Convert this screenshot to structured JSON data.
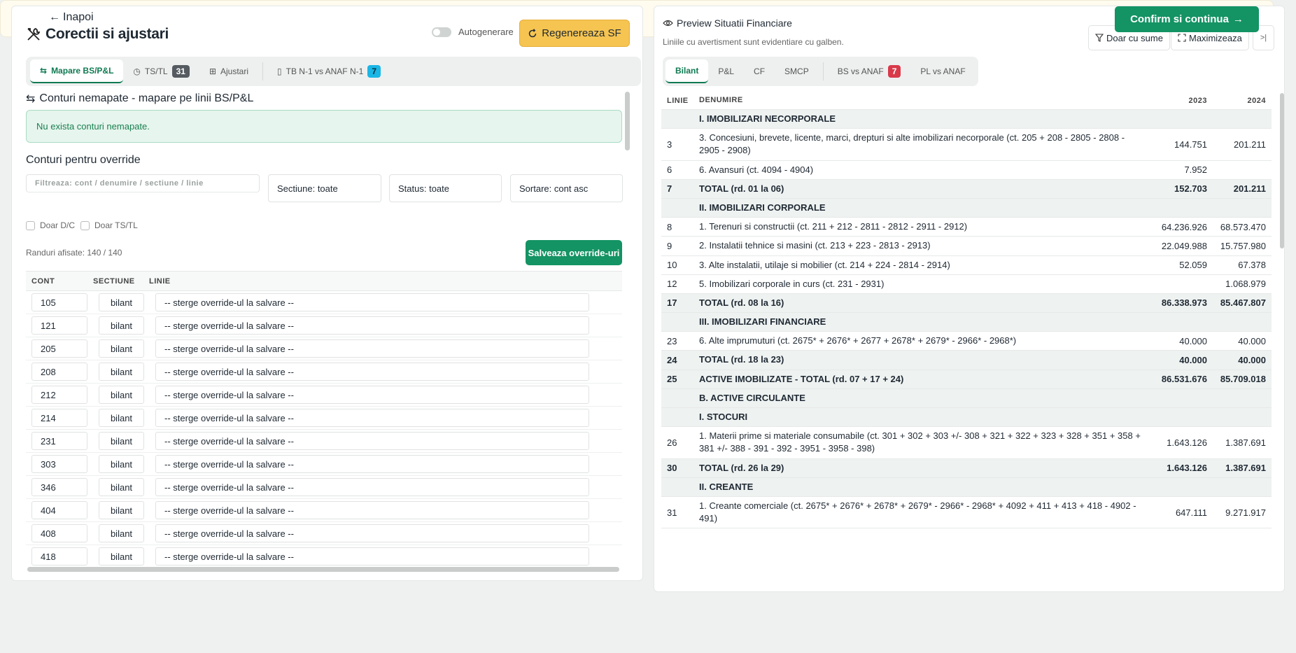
{
  "left": {
    "title": "Corectii si ajustari",
    "autogen_label": "Autogenerare",
    "regen_label": "Regenereaza SF",
    "tabs": [
      {
        "label": "Mapare BS/P&L",
        "badge": null
      },
      {
        "label": "TS/TL",
        "badge": "31"
      },
      {
        "label": "Ajustari",
        "badge": null
      },
      {
        "label": "TB N-1 vs ANAF N-1",
        "badge": "7"
      }
    ],
    "unmapped_title": "Conturi nemapate - mapare pe linii BS/P&L",
    "unmapped_msg": "Nu exista conturi nemapate.",
    "override_title": "Conturi pentru override",
    "filter_placeholder": "Filtreaza: cont / denumire / sectiune / linie",
    "section_select": "Sectiune: toate",
    "status_select": "Status: toate",
    "sort_select": "Sortare: cont asc",
    "chk_dc": "Doar D/C",
    "chk_tstl": "Doar TS/TL",
    "rows_info": "Randuri afisate: 140 / 140",
    "save_label": "Salveaza override-uri",
    "columns": [
      "CONT",
      "SECTIUNE",
      "LINIE"
    ],
    "rows": [
      {
        "cont": "105",
        "sectiune": "bilant",
        "linie": "-- sterge override-ul la salvare --"
      },
      {
        "cont": "121",
        "sectiune": "bilant",
        "linie": "-- sterge override-ul la salvare --"
      },
      {
        "cont": "205",
        "sectiune": "bilant",
        "linie": "-- sterge override-ul la salvare --"
      },
      {
        "cont": "208",
        "sectiune": "bilant",
        "linie": "-- sterge override-ul la salvare --"
      },
      {
        "cont": "212",
        "sectiune": "bilant",
        "linie": "-- sterge override-ul la salvare --"
      },
      {
        "cont": "214",
        "sectiune": "bilant",
        "linie": "-- sterge override-ul la salvare --"
      },
      {
        "cont": "231",
        "sectiune": "bilant",
        "linie": "-- sterge override-ul la salvare --"
      },
      {
        "cont": "303",
        "sectiune": "bilant",
        "linie": "-- sterge override-ul la salvare --"
      },
      {
        "cont": "346",
        "sectiune": "bilant",
        "linie": "-- sterge override-ul la salvare --"
      },
      {
        "cont": "404",
        "sectiune": "bilant",
        "linie": "-- sterge override-ul la salvare --"
      },
      {
        "cont": "408",
        "sectiune": "bilant",
        "linie": "-- sterge override-ul la salvare --"
      },
      {
        "cont": "418",
        "sectiune": "bilant",
        "linie": "-- sterge override-ul la salvare --"
      }
    ]
  },
  "right": {
    "title": "Preview Situatii Financiare",
    "subtitle": "Liniile cu avertisment sunt evidentiare cu galben.",
    "btn_sums": "Doar cu sume",
    "btn_max": "Maximizeaza",
    "btn_collapse": ">|",
    "tabs": [
      {
        "label": "Bilant",
        "badge": null
      },
      {
        "label": "P&L",
        "badge": null
      },
      {
        "label": "CF",
        "badge": null
      },
      {
        "label": "SMCP",
        "badge": null
      },
      {
        "label": "BS vs ANAF",
        "badge": "7"
      },
      {
        "label": "PL vs ANAF",
        "badge": null
      }
    ],
    "columns": [
      "LINIE",
      "DENUMIRE",
      "2023",
      "2024"
    ],
    "rows": [
      {
        "linie": "",
        "den": "I. IMOBILIZARI NECORPORALE",
        "v23": "",
        "v24": "",
        "kind": "tot"
      },
      {
        "linie": "3",
        "den": "3. Concesiuni, brevete, licente, marci, drepturi si alte imobilizari necorporale (ct. 205 + 208 - 2805 - 2808 - 2905 - 2908)",
        "v23": "144.751",
        "v24": "201.211",
        "kind": ""
      },
      {
        "linie": "6",
        "den": "6. Avansuri (ct. 4094 - 4904)",
        "v23": "7.952",
        "v24": "",
        "kind": ""
      },
      {
        "linie": "7",
        "den": "TOTAL (rd. 01 la 06)",
        "v23": "152.703",
        "v24": "201.211",
        "kind": "tot"
      },
      {
        "linie": "",
        "den": "II. IMOBILIZARI CORPORALE",
        "v23": "",
        "v24": "",
        "kind": "tot"
      },
      {
        "linie": "8",
        "den": "1. Terenuri si constructii (ct. 211 + 212 - 2811 - 2812 - 2911 - 2912)",
        "v23": "64.236.926",
        "v24": "68.573.470",
        "kind": ""
      },
      {
        "linie": "9",
        "den": "2. Instalatii tehnice si masini (ct. 213 + 223 - 2813 - 2913)",
        "v23": "22.049.988",
        "v24": "15.757.980",
        "kind": ""
      },
      {
        "linie": "10",
        "den": "3. Alte instalatii, utilaje si mobilier (ct. 214 + 224 - 2814 - 2914)",
        "v23": "52.059",
        "v24": "67.378",
        "kind": ""
      },
      {
        "linie": "12",
        "den": "5. Imobilizari corporale in curs (ct. 231 - 2931)",
        "v23": "",
        "v24": "1.068.979",
        "kind": ""
      },
      {
        "linie": "17",
        "den": "TOTAL (rd. 08 la 16)",
        "v23": "86.338.973",
        "v24": "85.467.807",
        "kind": "tot"
      },
      {
        "linie": "",
        "den": "III. IMOBILIZARI FINANCIARE",
        "v23": "",
        "v24": "",
        "kind": "tot"
      },
      {
        "linie": "23",
        "den": "6. Alte imprumuturi (ct. 2675* + 2676* + 2677 + 2678* + 2679* - 2966* - 2968*)",
        "v23": "40.000",
        "v24": "40.000",
        "kind": ""
      },
      {
        "linie": "24",
        "den": "TOTAL (rd. 18 la 23)",
        "v23": "40.000",
        "v24": "40.000",
        "kind": "tot"
      },
      {
        "linie": "25",
        "den": "ACTIVE IMOBILIZATE - TOTAL (rd. 07 + 17 + 24)",
        "v23": "86.531.676",
        "v24": "85.709.018",
        "kind": "tot"
      },
      {
        "linie": "",
        "den": "B. ACTIVE CIRCULANTE",
        "v23": "",
        "v24": "",
        "kind": "tot"
      },
      {
        "linie": "",
        "den": "I. STOCURI",
        "v23": "",
        "v24": "",
        "kind": "tot"
      },
      {
        "linie": "26",
        "den": "1. Materii prime si materiale consumabile (ct. 301 + 302 + 303 +/- 308 + 321 + 322 + 323 + 328 + 351 + 358 + 381 +/- 388 - 391 - 392 - 3951 - 3958 - 398)",
        "v23": "1.643.126",
        "v24": "1.387.691",
        "kind": ""
      },
      {
        "linie": "30",
        "den": "TOTAL (rd. 26 la 29)",
        "v23": "1.643.126",
        "v24": "1.387.691",
        "kind": "tot"
      },
      {
        "linie": "",
        "den": "II. CREANTE",
        "v23": "",
        "v24": "",
        "kind": "tot"
      },
      {
        "linie": "31",
        "den": "1. Creante comerciale (ct. 2675* + 2676* + 2678* + 2679* - 2966* - 2968* + 4092 + 411 + 413 + 418 - 4902 - 491)",
        "v23": "647.111",
        "v24": "9.271.917",
        "kind": ""
      }
    ]
  },
  "footer": {
    "back_label": "Inapoi",
    "confirm_label": "Confirm si continua"
  }
}
